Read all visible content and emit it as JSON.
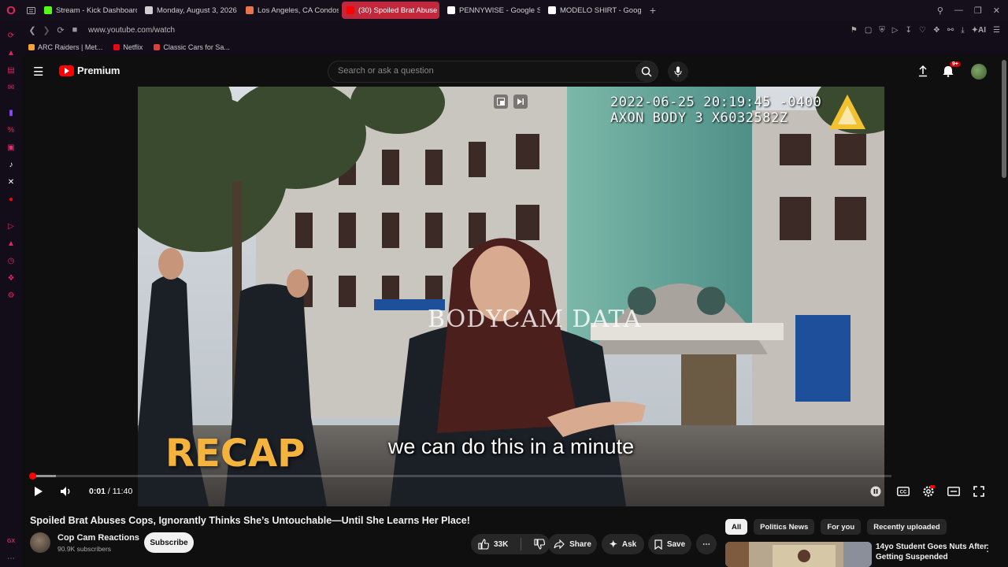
{
  "browser": {
    "tabs": [
      {
        "label": "Stream - Kick Dashboard",
        "color": "#53fc18",
        "active": false
      },
      {
        "label": "Monday, August 3, 2026 T",
        "color": "#cfcfcf",
        "active": false
      },
      {
        "label": "Los Angeles, CA Condos f",
        "color": "#e8744a",
        "active": false
      },
      {
        "label": "(30) Spoiled Brat Abuse",
        "color": "#ff0000",
        "active": true
      },
      {
        "label": "PENNYWISE - Google Sea",
        "color": "#ffffff",
        "active": false
      },
      {
        "label": "MODELO SHIRT - Google S",
        "color": "#ffffff",
        "active": false
      }
    ],
    "new_tab": "+",
    "url": "www.youtube.com/watch",
    "bookmarks": [
      {
        "label": "ARC Raiders | Met...",
        "color": "#f2a33a"
      },
      {
        "label": "Netflix",
        "color": "#e50914"
      },
      {
        "label": "Classic Cars for Sa...",
        "color": "#d94040"
      }
    ],
    "addr_ai": "AI",
    "sidebar_gx": "GX"
  },
  "youtube": {
    "logo_text": "Premium",
    "search_placeholder": "Search or ask a question",
    "notifications_badge": "9+",
    "video": {
      "timestamp_line1": "2022-06-25 20:19:45 -0400",
      "timestamp_line2": "AXON BODY 3 X6032582Z",
      "watermark": "BODYCAM DATA",
      "overlay_text": "RECAP",
      "caption": "we can do this in a minute",
      "current_time": "0:01",
      "duration": "11:40",
      "progress_fraction": 0.0014,
      "loaded_fraction": 0.03
    },
    "title": "Spoiled Brat Abuses Cops, Ignorantly Thinks She’s Untouchable—Until She Learns Her Place!",
    "channel": {
      "name": "Cop Cam Reactions",
      "subscribers": "90.9K subscribers",
      "subscribe_label": "Subscribe"
    },
    "actions": {
      "likes": "33K",
      "share": "Share",
      "ask": "Ask",
      "save": "Save"
    },
    "chips": [
      "All",
      "Politics News",
      "For you",
      "Recently uploaded"
    ],
    "recommended": [
      {
        "title": "14yo Student Goes Nuts After Getting Suspended"
      }
    ]
  }
}
